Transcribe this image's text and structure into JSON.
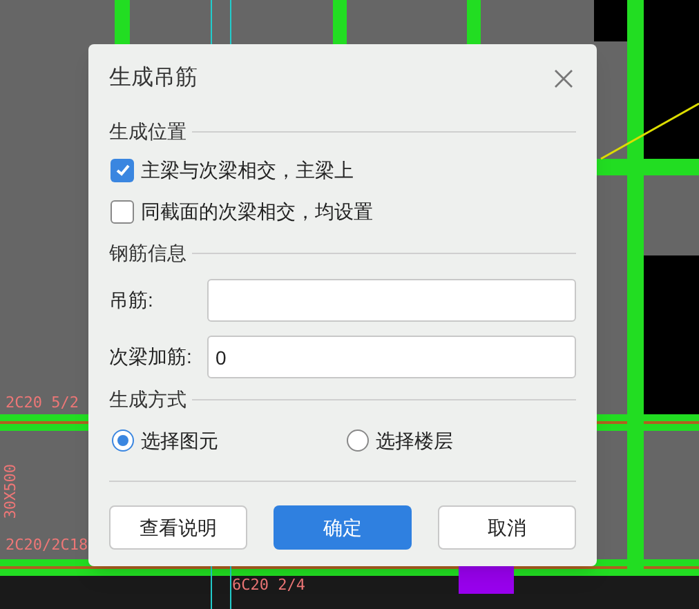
{
  "cad_labels": [
    {
      "text": "2C20 5/2",
      "kind": "horizontal"
    },
    {
      "text": "30X500",
      "kind": "vertical"
    },
    {
      "text": "2C20/2C18",
      "kind": "horizontal"
    },
    {
      "text": "6C20 2/4",
      "kind": "horizontal"
    }
  ],
  "dialog": {
    "title": "生成吊筋",
    "sections": [
      {
        "title": "生成位置",
        "kind": "checks",
        "items": [
          {
            "label": "主梁与次梁相交，主梁上",
            "checked": true
          },
          {
            "label": "同截面的次梁相交，均设置",
            "checked": false
          }
        ]
      },
      {
        "title": "钢筋信息",
        "kind": "fields",
        "items": [
          {
            "label": "吊筋:",
            "value": ""
          },
          {
            "label": "次梁加筋:",
            "value": "0"
          }
        ]
      },
      {
        "title": "生成方式",
        "kind": "radios",
        "items": [
          {
            "label": "选择图元",
            "selected": true
          },
          {
            "label": "选择楼层",
            "selected": false
          }
        ]
      }
    ],
    "buttons": [
      {
        "label": "查看说明",
        "primary": false
      },
      {
        "label": "确定",
        "primary": true
      },
      {
        "label": "取消",
        "primary": false
      }
    ]
  }
}
